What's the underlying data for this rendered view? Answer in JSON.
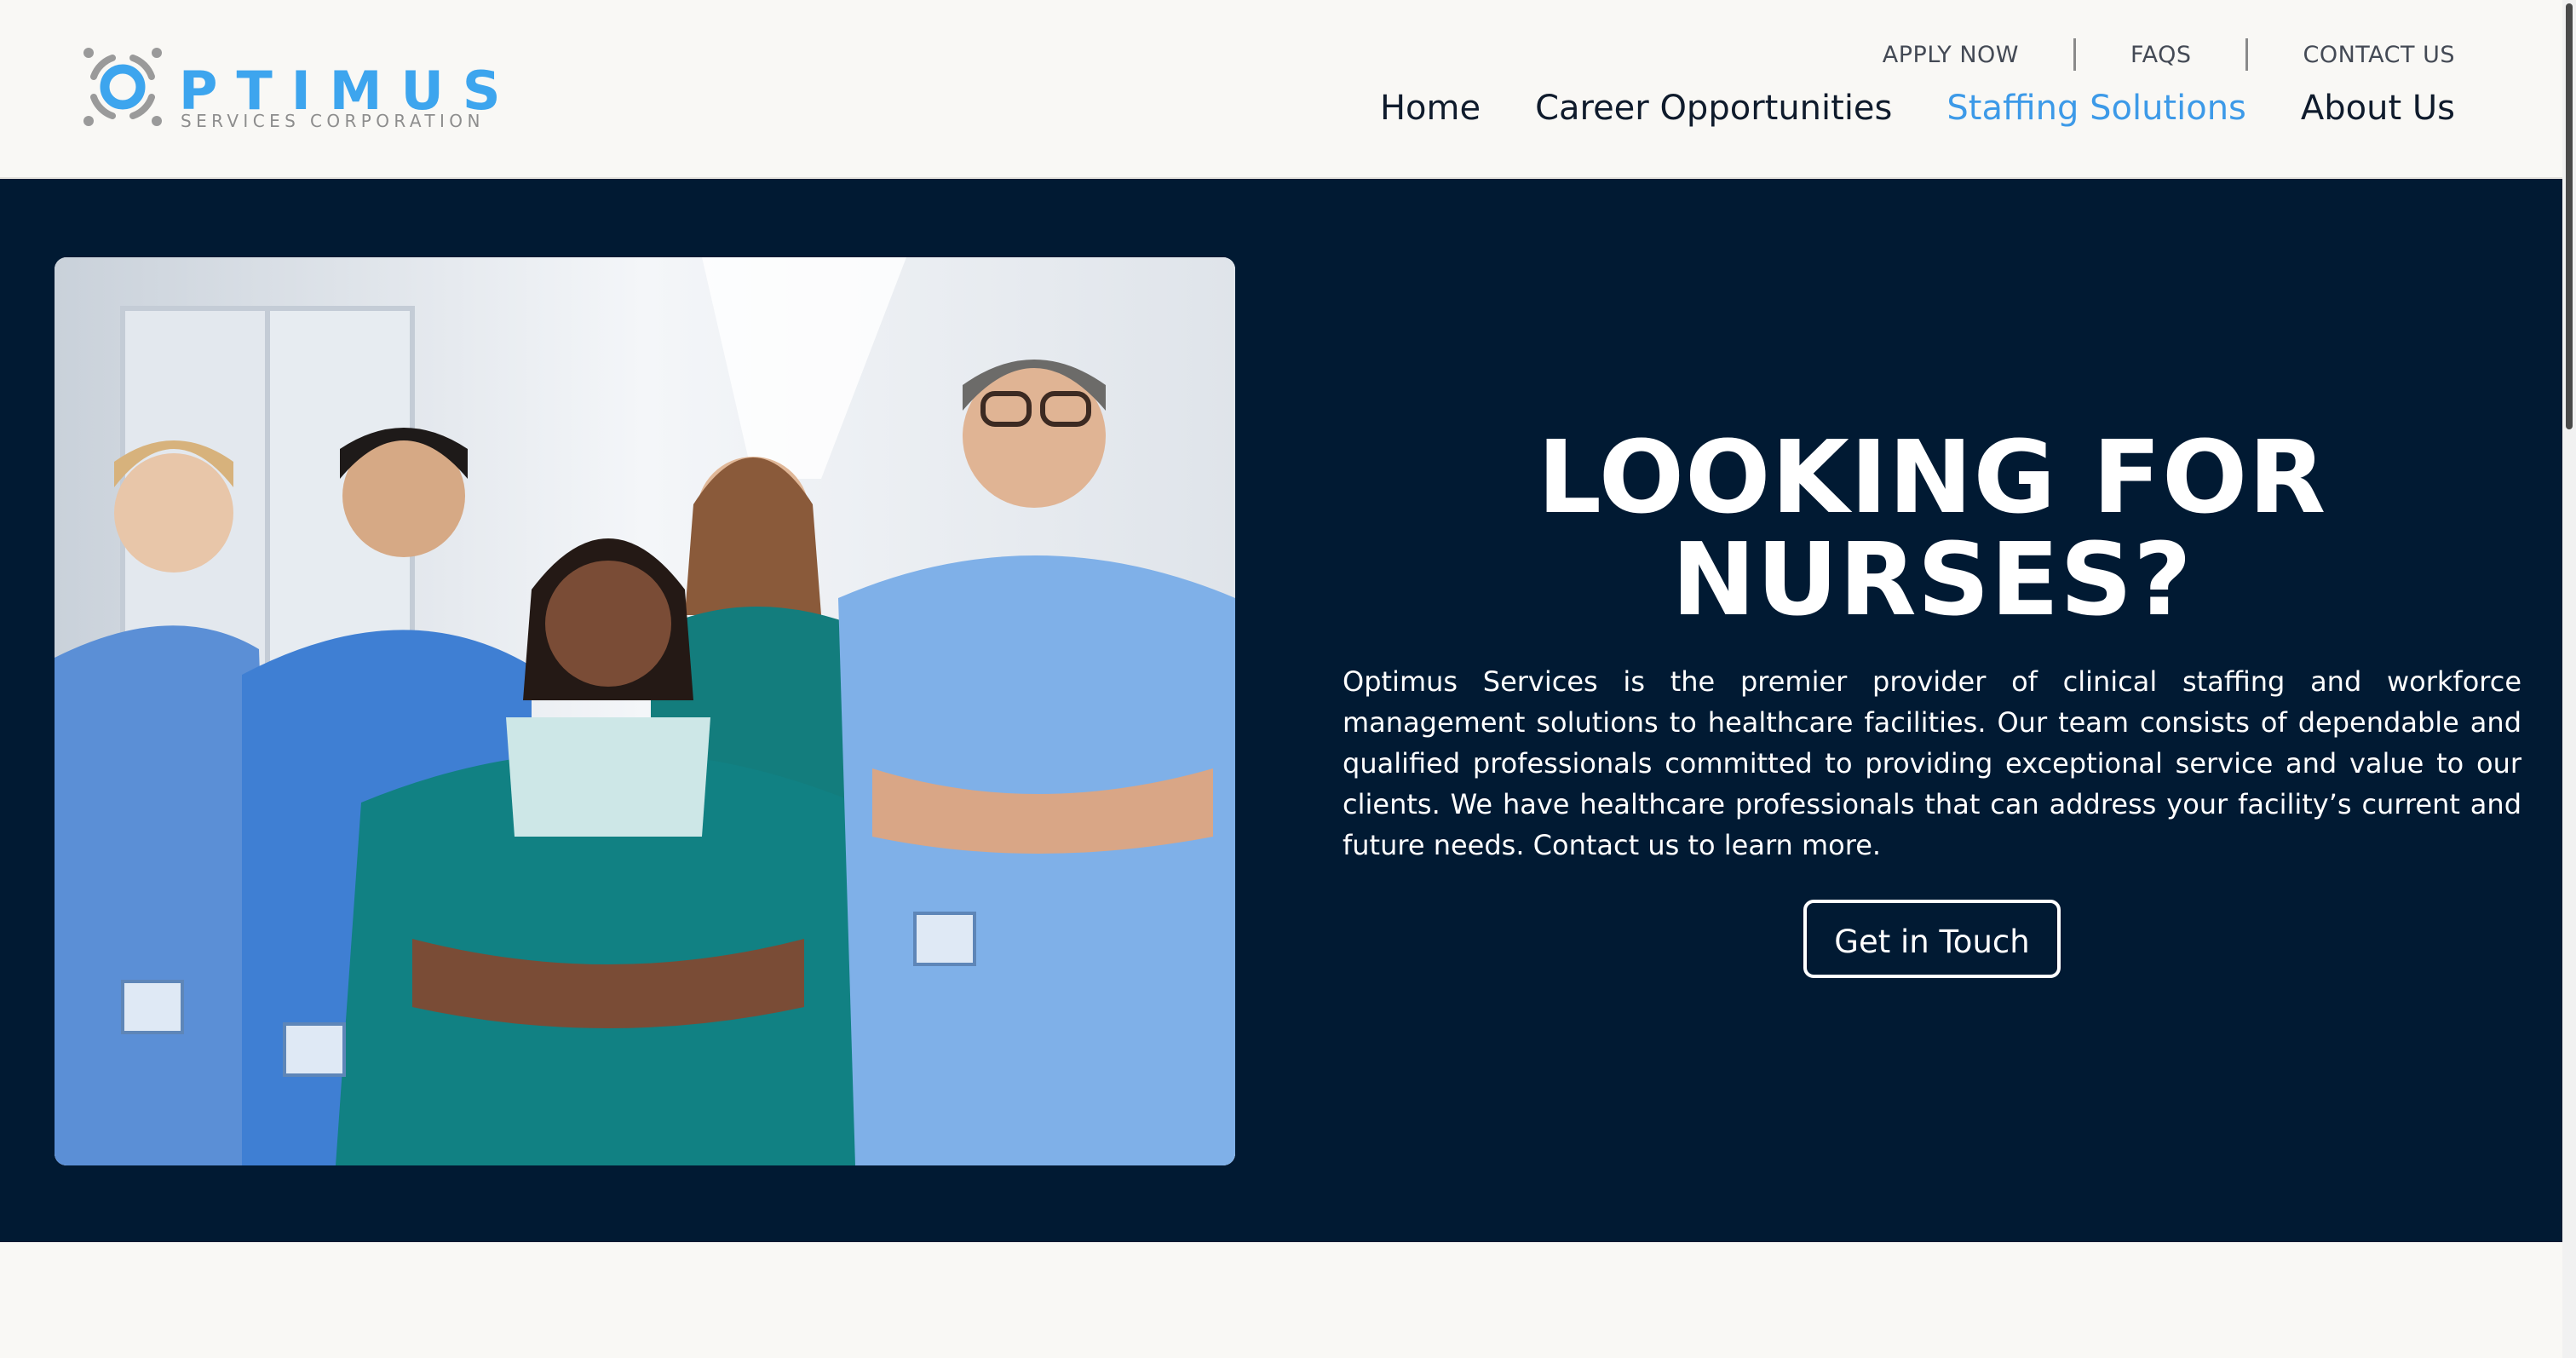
{
  "brand": {
    "name": "PTIMUS",
    "tagline": "SERVICES CORPORATION",
    "logo_icon": "optimus-o-ring-icon"
  },
  "utility_nav": {
    "apply": "APPLY NOW",
    "faqs": "FAQS",
    "contact": "CONTACT US"
  },
  "main_nav": {
    "items": [
      {
        "label": "Home",
        "active": false
      },
      {
        "label": "Career Opportunities",
        "active": false
      },
      {
        "label": "Staffing Solutions",
        "active": true
      },
      {
        "label": "About Us",
        "active": false
      }
    ]
  },
  "hero": {
    "title": "LOOKING FOR NURSES?",
    "body": "Optimus Services is the premier provider of clinical staffing and workforce management solutions to healthcare facilities. Our team consists of dependable and qualified professionals committed to providing exceptional service and value to our clients. We have healthcare professionals that can address your facility’s current and future needs. Contact us to learn more.",
    "cta_label": "Get in Touch",
    "image_alt": "Group of healthcare professionals in scrubs"
  },
  "colors": {
    "accent": "#3d9ae8",
    "hero_bg": "#011a33",
    "page_bg": "#f9f8f5",
    "nav_text": "#0f1b2c"
  }
}
